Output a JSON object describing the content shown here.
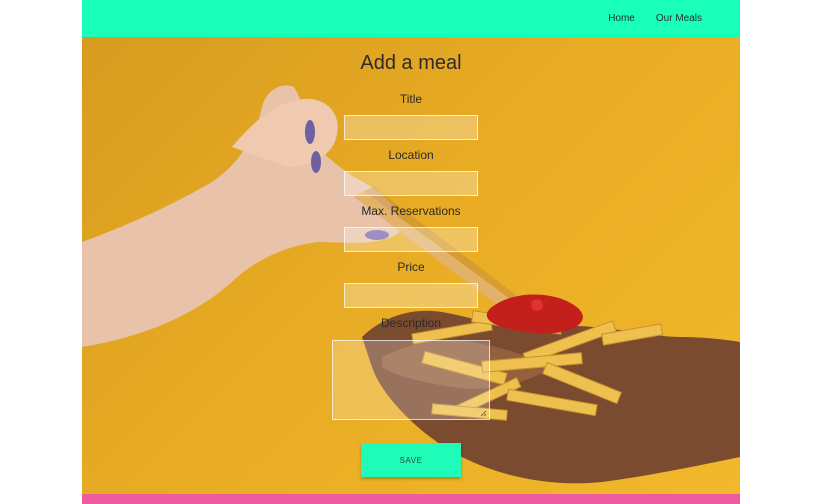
{
  "nav": {
    "home": "Home",
    "our_meals": "Our Meals"
  },
  "form": {
    "heading": "Add a meal",
    "title_label": "Title",
    "location_label": "Location",
    "max_reservations_label": "Max. Reservations",
    "price_label": "Price",
    "description_label": "Description",
    "save_label": "SAVE"
  },
  "colors": {
    "navbar": "#19ffb9",
    "footer": "#ef5b9f",
    "button": "#1ffcb8",
    "background": "#e8ab24"
  },
  "icons": {
    "photo": "hands-with-french-fries-photo"
  }
}
